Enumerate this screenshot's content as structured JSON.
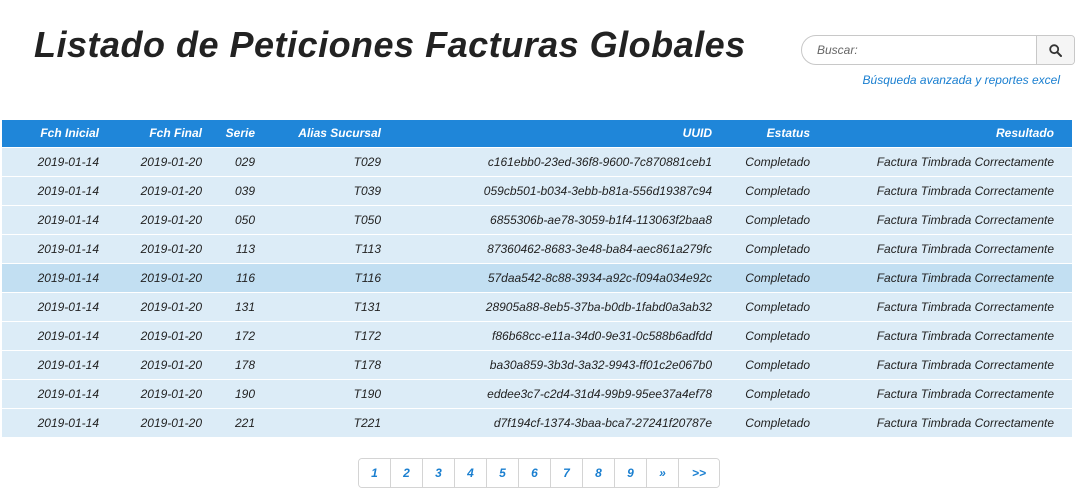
{
  "header": {
    "title": "Listado de Peticiones Facturas Globales",
    "search_placeholder": "Buscar:",
    "advanced_link": "Búsqueda avanzada y reportes excel"
  },
  "table": {
    "columns": [
      "Fch Inicial",
      "Fch Final",
      "Serie",
      "Alias Sucursal",
      "UUID",
      "Estatus",
      "Resultado"
    ],
    "rows": [
      [
        "2019-01-14",
        "2019-01-20",
        "029",
        "T029",
        "c161ebb0-23ed-36f8-9600-7c870881ceb1",
        "Completado",
        "Factura Timbrada Correctamente"
      ],
      [
        "2019-01-14",
        "2019-01-20",
        "039",
        "T039",
        "059cb501-b034-3ebb-b81a-556d19387c94",
        "Completado",
        "Factura Timbrada Correctamente"
      ],
      [
        "2019-01-14",
        "2019-01-20",
        "050",
        "T050",
        "6855306b-ae78-3059-b1f4-113063f2baa8",
        "Completado",
        "Factura Timbrada Correctamente"
      ],
      [
        "2019-01-14",
        "2019-01-20",
        "113",
        "T113",
        "87360462-8683-3e48-ba84-aec861a279fc",
        "Completado",
        "Factura Timbrada Correctamente"
      ],
      [
        "2019-01-14",
        "2019-01-20",
        "116",
        "T116",
        "57daa542-8c88-3934-a92c-f094a034e92c",
        "Completado",
        "Factura Timbrada Correctamente"
      ],
      [
        "2019-01-14",
        "2019-01-20",
        "131",
        "T131",
        "28905a88-8eb5-37ba-b0db-1fabd0a3ab32",
        "Completado",
        "Factura Timbrada Correctamente"
      ],
      [
        "2019-01-14",
        "2019-01-20",
        "172",
        "T172",
        "f86b68cc-e11a-34d0-9e31-0c588b6adfdd",
        "Completado",
        "Factura Timbrada Correctamente"
      ],
      [
        "2019-01-14",
        "2019-01-20",
        "178",
        "T178",
        "ba30a859-3b3d-3a32-9943-ff01c2e067b0",
        "Completado",
        "Factura Timbrada Correctamente"
      ],
      [
        "2019-01-14",
        "2019-01-20",
        "190",
        "T190",
        "eddee3c7-c2d4-31d4-99b9-95ee37a4ef78",
        "Completado",
        "Factura Timbrada Correctamente"
      ],
      [
        "2019-01-14",
        "2019-01-20",
        "221",
        "T221",
        "d7f194cf-1374-3baa-bca7-27241f20787e",
        "Completado",
        "Factura Timbrada Correctamente"
      ]
    ]
  },
  "pagination": {
    "pages": [
      "1",
      "2",
      "3",
      "4",
      "5",
      "6",
      "7",
      "8",
      "9"
    ],
    "next": "»",
    "last": ">>"
  },
  "icons": {
    "search": "search-icon"
  },
  "colors": {
    "header_bg": "#1f86d9",
    "row_bg": "#dcecf7",
    "row_highlight": "#c2dff2",
    "link": "#1a7fd0",
    "title": "#222222"
  }
}
